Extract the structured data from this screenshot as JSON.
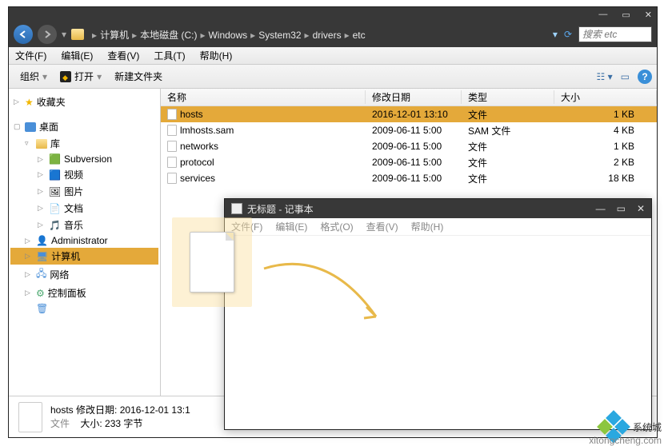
{
  "explorer": {
    "breadcrumb": [
      "计算机",
      "本地磁盘 (C:)",
      "Windows",
      "System32",
      "drivers",
      "etc"
    ],
    "search_placeholder": "搜索 etc",
    "menu": {
      "file": "文件(F)",
      "edit": "编辑(E)",
      "view": "查看(V)",
      "tools": "工具(T)",
      "help": "帮助(H)"
    },
    "toolbar": {
      "organize": "组织",
      "open": "打开",
      "new_folder": "新建文件夹"
    },
    "columns": {
      "name": "名称",
      "date": "修改日期",
      "type": "类型",
      "size": "大小"
    },
    "files": [
      {
        "name": "hosts",
        "date": "2016-12-01 13:10",
        "type": "文件",
        "size": "1 KB",
        "selected": true
      },
      {
        "name": "lmhosts.sam",
        "date": "2009-06-11 5:00",
        "type": "SAM 文件",
        "size": "4 KB",
        "selected": false
      },
      {
        "name": "networks",
        "date": "2009-06-11 5:00",
        "type": "文件",
        "size": "1 KB",
        "selected": false
      },
      {
        "name": "protocol",
        "date": "2009-06-11 5:00",
        "type": "文件",
        "size": "2 KB",
        "selected": false
      },
      {
        "name": "services",
        "date": "2009-06-11 5:00",
        "type": "文件",
        "size": "18 KB",
        "selected": false
      }
    ],
    "sidebar": {
      "favorites": "收藏夹",
      "desktop": "桌面",
      "library": "库",
      "items": [
        "Subversion",
        "视频",
        "图片",
        "文档",
        "音乐"
      ],
      "admin": "Administrator",
      "computer": "计算机",
      "network": "网络",
      "control_panel": "控制面板"
    },
    "status": {
      "file": "hosts",
      "date_label": "修改日期:",
      "date": "2016-12-01 13:1",
      "type": "文件",
      "size_label": "大小:",
      "size": "233 字节"
    }
  },
  "notepad": {
    "title": "无标题 - 记事本",
    "menu": {
      "file": "文件(F)",
      "edit": "编辑(E)",
      "format": "格式(O)",
      "view": "查看(V)",
      "help": "帮助(H)"
    }
  },
  "watermark": {
    "text": "系统城",
    "url": "xitongcheng.com"
  }
}
